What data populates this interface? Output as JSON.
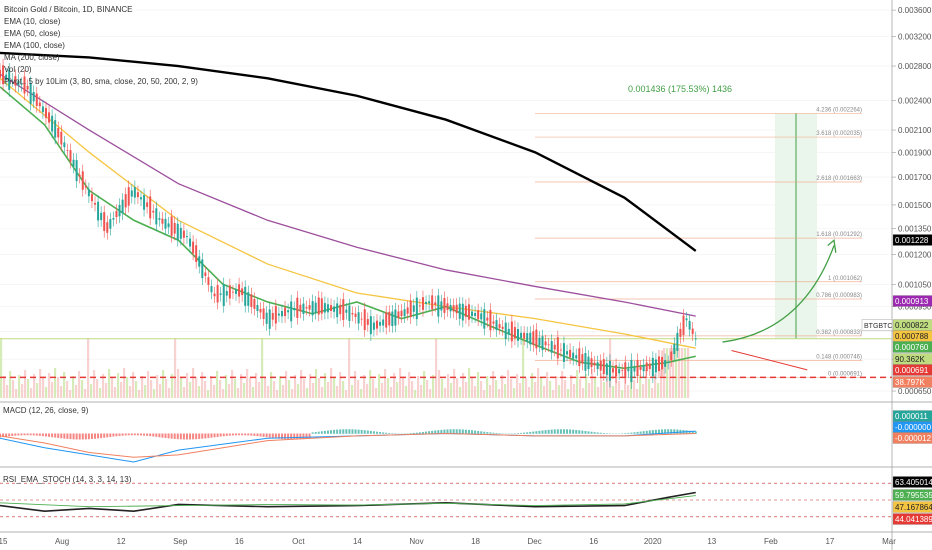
{
  "header": {
    "title": "Bitcoin Gold / Bitcoin, 1D, BINANCE",
    "indicators": [
      "EMA (10, close)",
      "EMA (50, close)",
      "EMA (100, close)",
      "MA (200, close)",
      "Vol (20)",
      "Pivot.. 5 by 10Lim (3, 80, sma, close, 20, 50, 200, 2, 9)"
    ]
  },
  "colors": {
    "up": "#26a69a",
    "down": "#ef5350",
    "ema10": "#4caf50",
    "ema50": "#f5c542",
    "ema100": "#9c4f9c",
    "ma200": "#000000",
    "fib": "#f0a080",
    "price_line": "#c0dc80",
    "support": "#e53935"
  },
  "chart_data": [
    {
      "type": "line",
      "title": "Bitcoin Gold / Bitcoin, 1D, BINANCE",
      "x_ticks": [
        "15",
        "Aug",
        "12",
        "Sep",
        "16",
        "Oct",
        "14",
        "Nov",
        "18",
        "Dec",
        "16",
        "2020",
        "13",
        "Feb",
        "17",
        "Mar"
      ],
      "y_ticks": [
        "0.003600",
        "0.003200",
        "0.002800",
        "0.002400",
        "0.002100",
        "0.001900",
        "0.001700",
        "0.001500",
        "0.001350",
        "0.001200",
        "0.001050",
        "0.000950",
        "0.000850",
        "0.000750",
        "0.000650"
      ],
      "ylim": [
        0.00063,
        0.0037
      ],
      "log_scale": true,
      "series": [
        {
          "name": "MA (200, close)",
          "x": [
            0,
            0.1,
            0.2,
            0.3,
            0.4,
            0.5,
            0.6,
            0.7,
            0.78
          ],
          "y": [
            0.00297,
            0.00291,
            0.0028,
            0.00265,
            0.00245,
            0.0022,
            0.0019,
            0.00155,
            0.00122
          ]
        },
        {
          "name": "EMA (100, close)",
          "x": [
            0,
            0.1,
            0.2,
            0.3,
            0.4,
            0.5,
            0.6,
            0.7,
            0.78
          ],
          "y": [
            0.0027,
            0.0021,
            0.00165,
            0.0014,
            0.00124,
            0.00112,
            0.00104,
            0.00097,
            0.00091
          ]
        },
        {
          "name": "EMA (50, close)",
          "x": [
            0,
            0.1,
            0.2,
            0.3,
            0.4,
            0.5,
            0.6,
            0.7,
            0.78
          ],
          "y": [
            0.00265,
            0.0019,
            0.0014,
            0.00115,
            0.00101,
            0.00095,
            0.0009,
            0.00084,
            0.000788
          ]
        },
        {
          "name": "EMA (10, close)",
          "x": [
            0,
            0.05,
            0.1,
            0.15,
            0.2,
            0.25,
            0.3,
            0.35,
            0.4,
            0.45,
            0.5,
            0.55,
            0.6,
            0.65,
            0.7,
            0.75,
            0.78
          ],
          "y": [
            0.00255,
            0.00215,
            0.0016,
            0.0014,
            0.00128,
            0.00105,
            0.00097,
            0.00092,
            0.00097,
            0.0009,
            0.00095,
            0.00087,
            0.0008,
            0.00074,
            0.00072,
            0.00074,
            0.00076
          ]
        },
        {
          "name": "BTGBTC",
          "x": [
            0,
            0.03,
            0.06,
            0.09,
            0.12,
            0.15,
            0.18,
            0.21,
            0.24,
            0.27,
            0.3,
            0.33,
            0.36,
            0.39,
            0.42,
            0.45,
            0.48,
            0.51,
            0.54,
            0.57,
            0.6,
            0.63,
            0.66,
            0.69,
            0.72,
            0.75,
            0.77,
            0.78
          ],
          "y": [
            0.0027,
            0.00255,
            0.00215,
            0.0017,
            0.00135,
            0.0016,
            0.0014,
            0.0013,
            0.001,
            0.00102,
            0.0009,
            0.00094,
            0.00095,
            0.00093,
            0.00087,
            0.00092,
            0.00097,
            0.00094,
            0.00091,
            0.00085,
            0.00082,
            0.00078,
            0.00074,
            0.00071,
            0.00072,
            0.00074,
            0.0009,
            0.000822
          ]
        }
      ],
      "fib_levels": [
        {
          "label": "4.236 (0.002264)",
          "value": 0.002264
        },
        {
          "label": "3.618 (0.002035)",
          "value": 0.002035
        },
        {
          "label": "2.618 (0.001663)",
          "value": 0.001663
        },
        {
          "label": "1.618 (0.001292)",
          "value": 0.001292
        },
        {
          "label": "1 (0.001062)",
          "value": 0.001062
        },
        {
          "label": "0.786 (0.000983)",
          "value": 0.000983
        },
        {
          "label": "0.382 (0.000833)",
          "value": 0.000833
        },
        {
          "label": "0.148 (0.000746)",
          "value": 0.000746
        },
        {
          "label": "0 (0.000691)",
          "value": 0.000691
        }
      ],
      "measure_label": "0.001436 (175.53%) 1436",
      "price_tags": [
        {
          "text": "0.001228",
          "color": "#000000"
        },
        {
          "text": "0.000913",
          "color": "#9c27b0"
        },
        {
          "text": "BTGBTC",
          "color": "#ffffff"
        },
        {
          "text": "0.000822",
          "color": "#c0dc80"
        },
        {
          "text": "0.000788",
          "color": "#f5c542"
        },
        {
          "text": "0.000760",
          "color": "#4caf50"
        },
        {
          "text": "90.362K",
          "color": "#c0dc80"
        },
        {
          "text": "0.000691",
          "color": "#e53935"
        },
        {
          "text": "38.797K",
          "color": "#f08060"
        }
      ]
    },
    {
      "type": "line",
      "title": "MACD (12, 26, close, 9)",
      "ylim": [
        -0.00012,
        0.00012
      ],
      "series": [
        {
          "name": "MACD",
          "x": [
            0,
            0.05,
            0.1,
            0.15,
            0.2,
            0.3,
            0.4,
            0.5,
            0.6,
            0.7,
            0.78
          ],
          "y": [
            -2e-05,
            -6e-05,
            -9e-05,
            -0.00012,
            -7e-05,
            -2e-05,
            -1e-05,
            0.0,
            -1e-05,
            -1e-05,
            1e-05
          ]
        },
        {
          "name": "Signal",
          "x": [
            0,
            0.05,
            0.1,
            0.15,
            0.2,
            0.3,
            0.4,
            0.5,
            0.6,
            0.7,
            0.78
          ],
          "y": [
            -1e-05,
            -4e-05,
            -8e-05,
            -0.0001,
            -9e-05,
            -3e-05,
            -1e-05,
            0.0,
            -1e-05,
            -1e-05,
            0.0
          ]
        }
      ],
      "price_tags": [
        {
          "text": "0.000011",
          "color": "#26a69a"
        },
        {
          "text": "-0.000000",
          "color": "#2196f3"
        },
        {
          "text": "-0.000012",
          "color": "#f08060"
        }
      ]
    },
    {
      "type": "line",
      "title": "RSI_EMA_STOCH (14, 3, 3, 14, 13)",
      "ylim": [
        0,
        100
      ],
      "series": [
        {
          "name": "RSI",
          "x": [
            0,
            0.05,
            0.1,
            0.15,
            0.2,
            0.3,
            0.4,
            0.5,
            0.6,
            0.7,
            0.75,
            0.78
          ],
          "y": [
            40,
            30,
            35,
            30,
            42,
            38,
            40,
            45,
            38,
            40,
            55,
            63.4
          ]
        },
        {
          "name": "EMA",
          "x": [
            0,
            0.1,
            0.2,
            0.3,
            0.4,
            0.5,
            0.6,
            0.7,
            0.78
          ],
          "y": [
            45,
            38,
            40,
            42,
            41,
            44,
            40,
            43,
            58
          ]
        }
      ],
      "price_tags": [
        {
          "text": "63.405014",
          "color": "#000000"
        },
        {
          "text": "59.795535",
          "color": "#4caf50"
        },
        {
          "text": "47.167864",
          "color": "#f5c542"
        },
        {
          "text": "44.041389",
          "color": "#e53935"
        }
      ]
    }
  ]
}
